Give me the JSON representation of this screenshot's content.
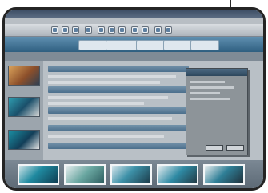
{
  "window": {
    "title": "",
    "menus": []
  },
  "toolbar": {
    "buttons": [
      {
        "icon": "new-icon"
      },
      {
        "icon": "open-icon"
      },
      {
        "icon": "save-icon"
      },
      {
        "icon": "print-icon"
      },
      {
        "icon": "cut-icon"
      },
      {
        "icon": "copy-icon"
      },
      {
        "icon": "paste-icon"
      },
      {
        "icon": "undo-icon"
      },
      {
        "icon": "redo-icon"
      },
      {
        "icon": "zoom-icon"
      },
      {
        "icon": "help-icon"
      }
    ]
  },
  "ribbon": {
    "buttons": []
  },
  "breadcrumb": {
    "text": ""
  },
  "main": {
    "rows": []
  },
  "dialog": {
    "title": "",
    "ok_label": "",
    "cancel_label": ""
  },
  "colors": {
    "accent": "#4c6f8c",
    "titlebar": "#3b4c64",
    "ribbon": "#2f5f80",
    "filmstrip": "#5d6a76"
  }
}
